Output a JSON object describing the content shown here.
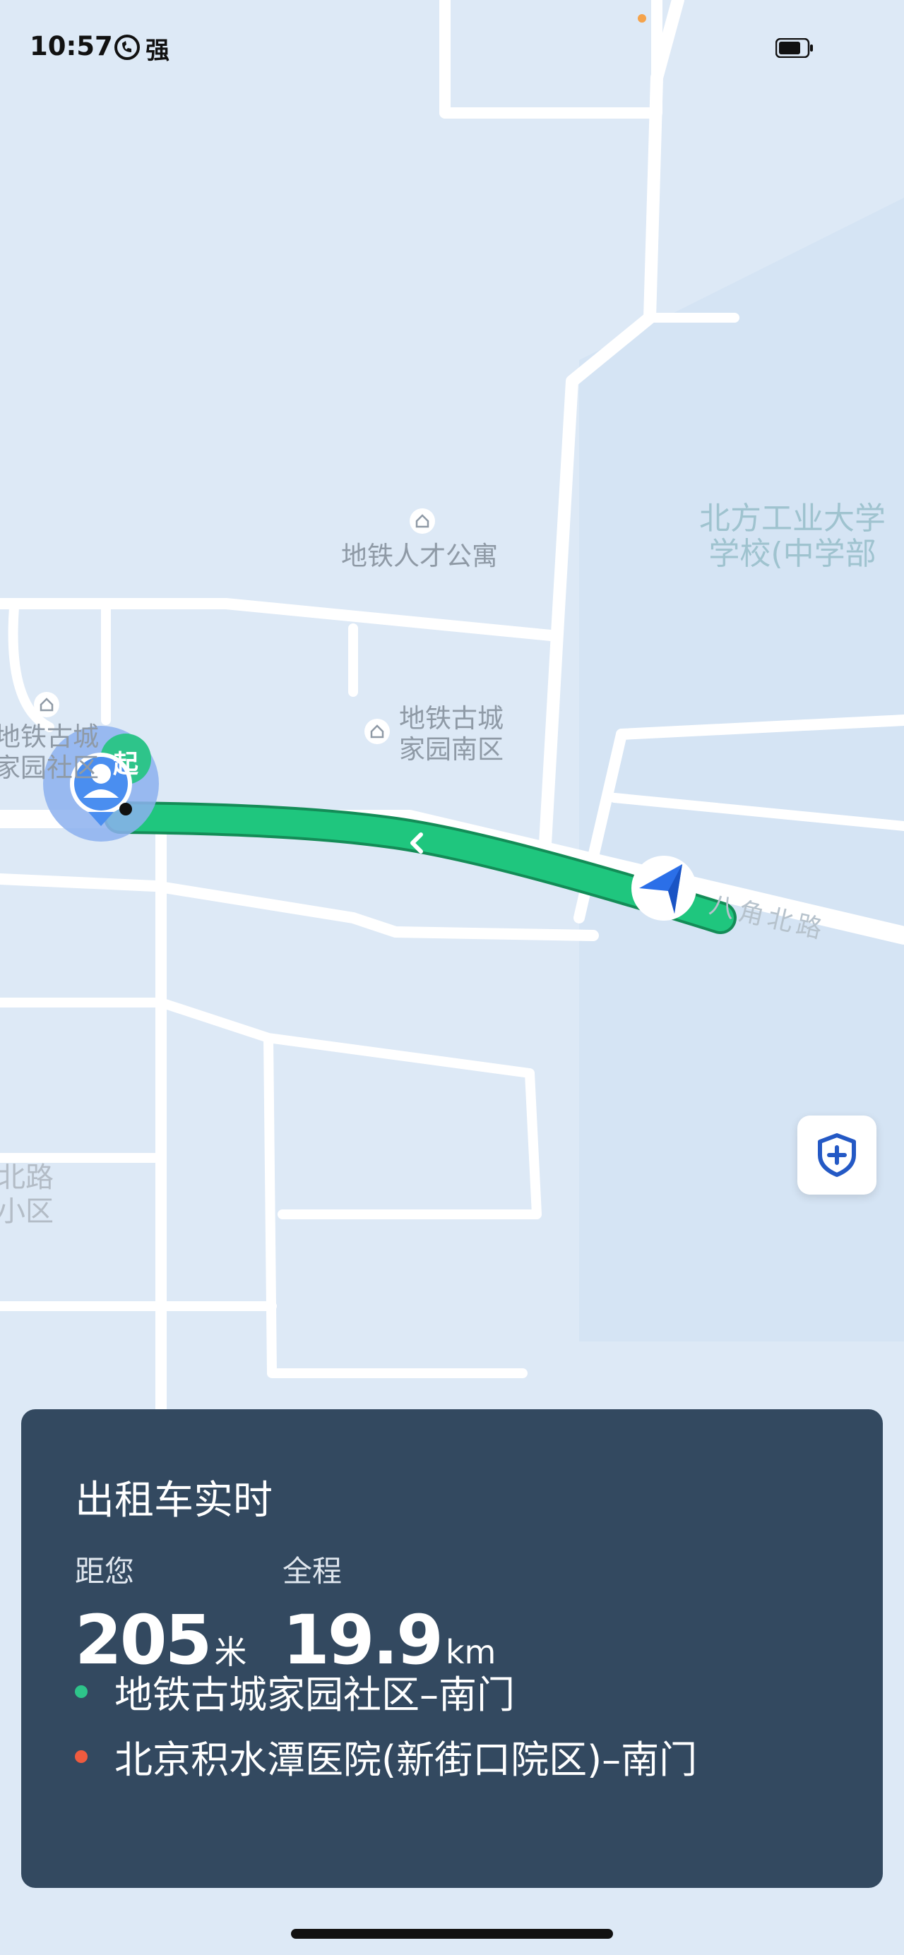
{
  "status_bar": {
    "time": "10:57",
    "signal_text": "强",
    "signal_icon": "hd-call-icon",
    "battery_icon": "battery-icon"
  },
  "map": {
    "labels": {
      "subway_talent": "地铁人才公寓",
      "gucheng_south_1": "地铁古城",
      "gucheng_south_2": "家园南区",
      "gucheng_community_1": "地铁古城",
      "gucheng_community_2": "家园社区",
      "ncut_school_1": "北方工业大学",
      "ncut_school_2": "学校(中学部",
      "north_road_1": "北路",
      "north_road_2": "小区",
      "road_name": "八角北路"
    },
    "start_marker_text": "起",
    "colors": {
      "route": "#1fc67e",
      "route_border": "#148c57",
      "road": "#ffffff",
      "block": "#dde9f6",
      "vehicle": "#2b6fe8"
    }
  },
  "safety_button": {
    "icon": "shield-plus-icon"
  },
  "card": {
    "title": "出租车实时",
    "distance_label": "距您",
    "distance_value": "205",
    "distance_unit": "米",
    "total_label": "全程",
    "total_value": "19.9",
    "total_unit": "km",
    "origin": "地铁古城家园社区–南门",
    "destination": "北京积水潭医院(新街口院区)–南门",
    "origin_color": "#2ec48a",
    "destination_color": "#ef5b3f"
  }
}
